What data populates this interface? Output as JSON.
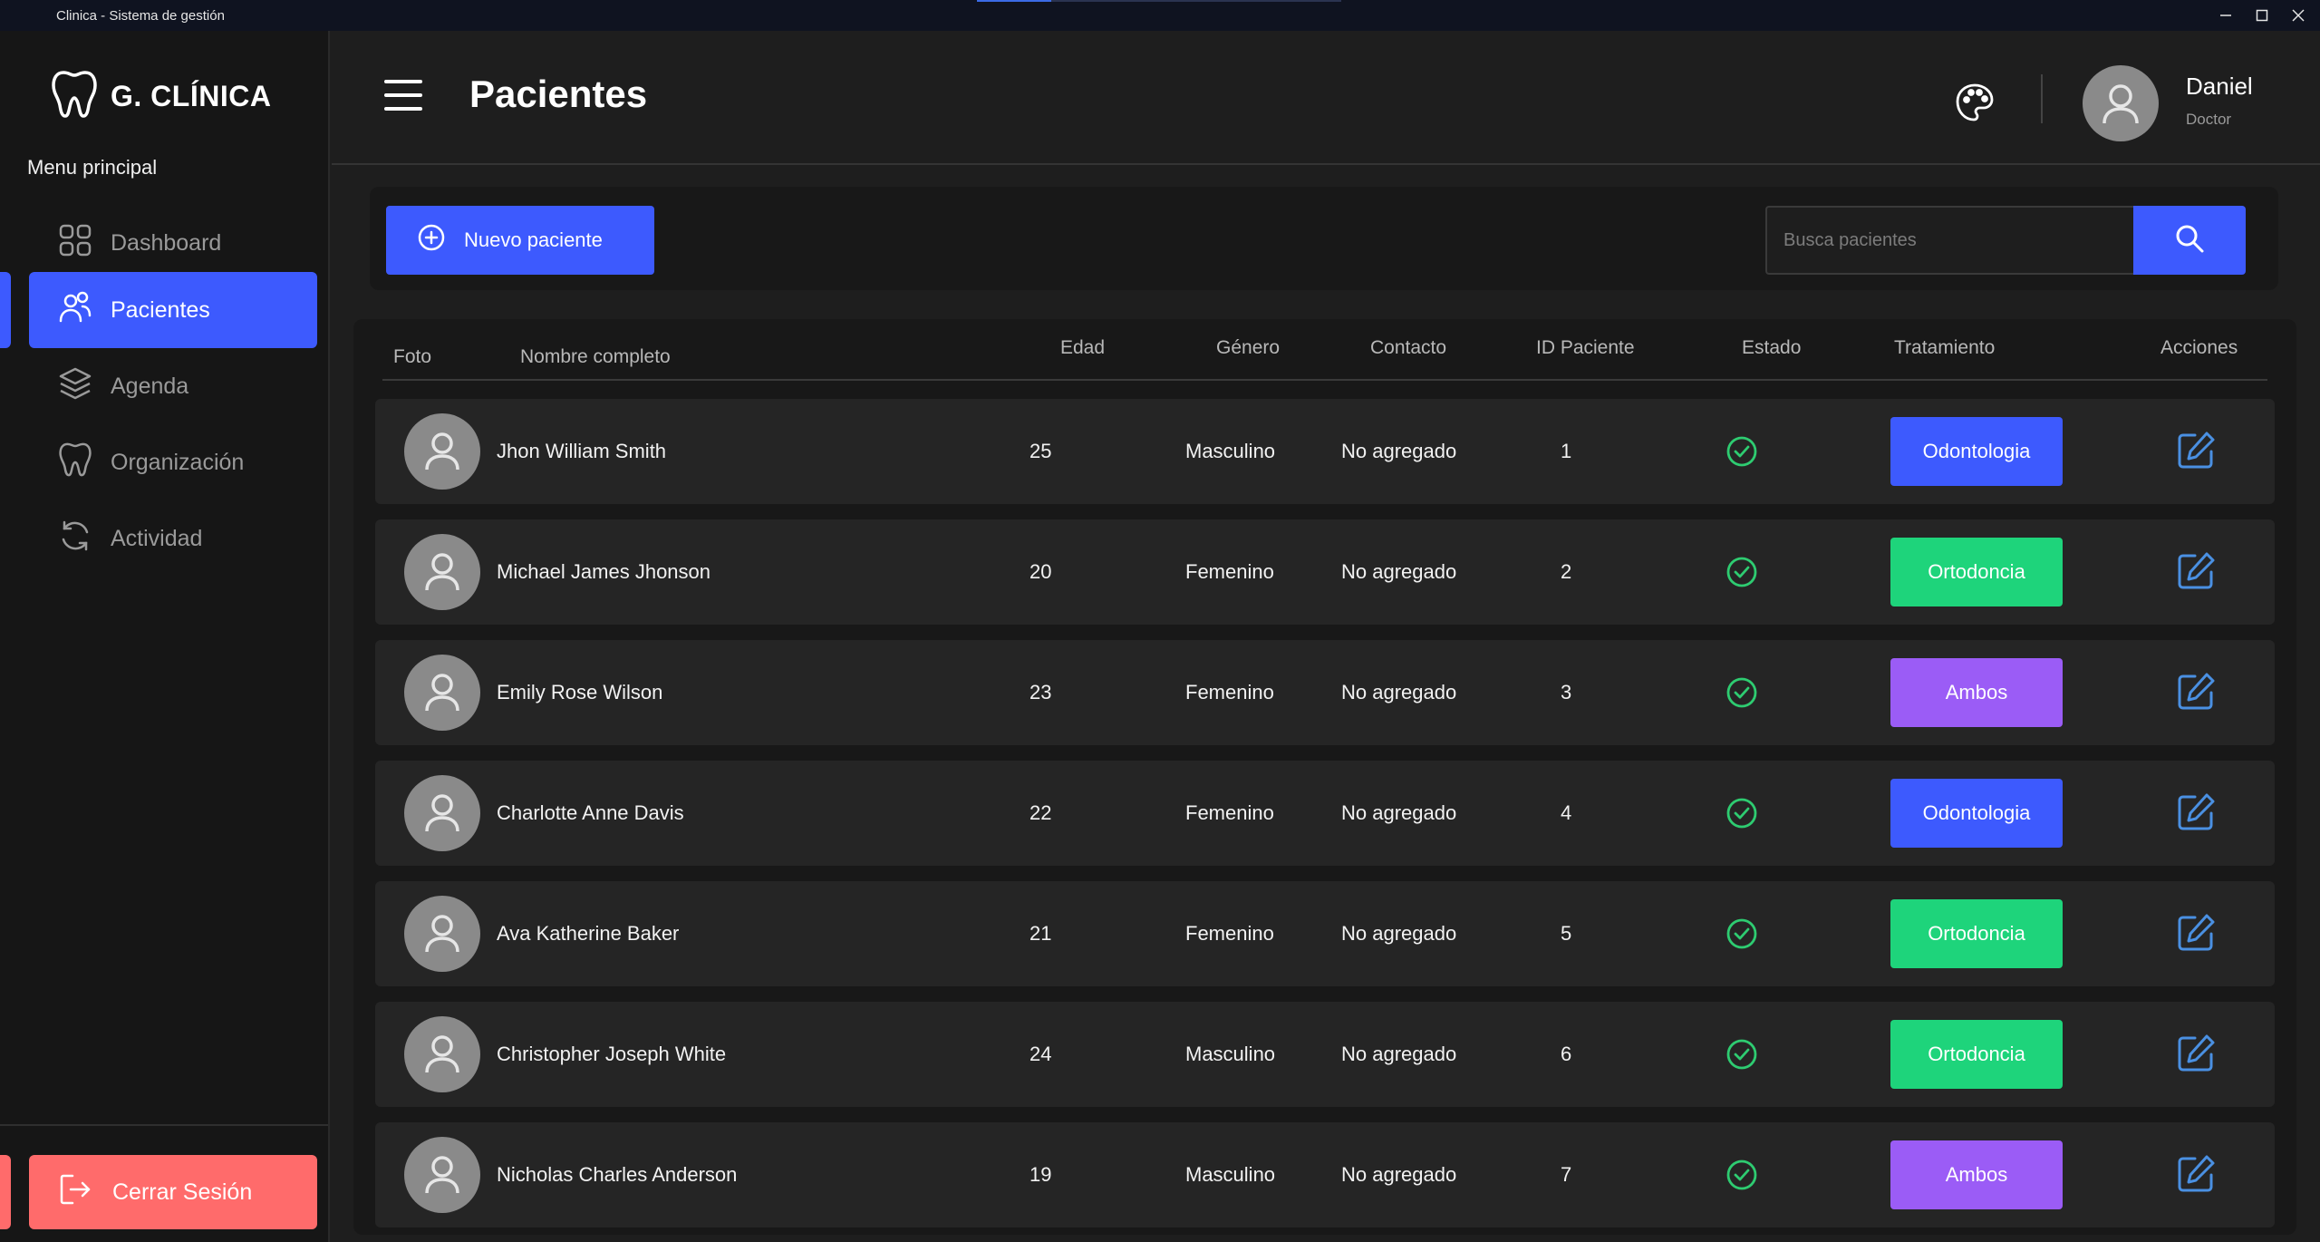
{
  "window": {
    "title": "Clinica - Sistema de gestión"
  },
  "sidebar": {
    "brand": "G. CLÍNICA",
    "menu_title": "Menu principal",
    "items": [
      {
        "label": "Dashboard",
        "icon": "grid-icon",
        "active": false
      },
      {
        "label": "Pacientes",
        "icon": "users-icon",
        "active": true
      },
      {
        "label": "Agenda",
        "icon": "layers-icon",
        "active": false
      },
      {
        "label": "Organización",
        "icon": "tooth-icon",
        "active": false
      },
      {
        "label": "Actividad",
        "icon": "refresh-icon",
        "active": false
      }
    ],
    "logout_label": "Cerrar Sesión"
  },
  "header": {
    "title": "Pacientes",
    "user_name": "Daniel",
    "user_role": "Doctor"
  },
  "toolbar": {
    "new_patient_label": "Nuevo paciente",
    "search_placeholder": "Busca pacientes"
  },
  "table": {
    "columns": [
      "Foto",
      "Nombre completo",
      "Edad",
      "Género",
      "Contacto",
      "ID Paciente",
      "Estado",
      "Tratamiento",
      "Acciones"
    ],
    "rows": [
      {
        "name": "Jhon William Smith",
        "age": "25",
        "gender": "Masculino",
        "contact": "No agregado",
        "id": "1",
        "treatment": "Odontologia"
      },
      {
        "name": "Michael James Jhonson",
        "age": "20",
        "gender": "Femenino",
        "contact": "No agregado",
        "id": "2",
        "treatment": "Ortodoncia"
      },
      {
        "name": "Emily Rose Wilson",
        "age": "23",
        "gender": "Femenino",
        "contact": "No agregado",
        "id": "3",
        "treatment": "Ambos"
      },
      {
        "name": "Charlotte Anne Davis",
        "age": "22",
        "gender": "Femenino",
        "contact": "No agregado",
        "id": "4",
        "treatment": "Odontologia"
      },
      {
        "name": "Ava Katherine Baker",
        "age": "21",
        "gender": "Femenino",
        "contact": "No agregado",
        "id": "5",
        "treatment": "Ortodoncia"
      },
      {
        "name": "Christopher Joseph White",
        "age": "24",
        "gender": "Masculino",
        "contact": "No agregado",
        "id": "6",
        "treatment": "Ortodoncia"
      },
      {
        "name": "Nicholas Charles Anderson",
        "age": "19",
        "gender": "Masculino",
        "contact": "No agregado",
        "id": "7",
        "treatment": "Ambos"
      }
    ]
  },
  "colors": {
    "accent": "#3d5afe",
    "Odontologia": "#3d5afe",
    "Ortodoncia": "#1ed47b",
    "Ambos": "#9b5cf6",
    "status_ok": "#2ecc71",
    "edit": "#4a90e2",
    "logout": "#ff6b6b"
  }
}
